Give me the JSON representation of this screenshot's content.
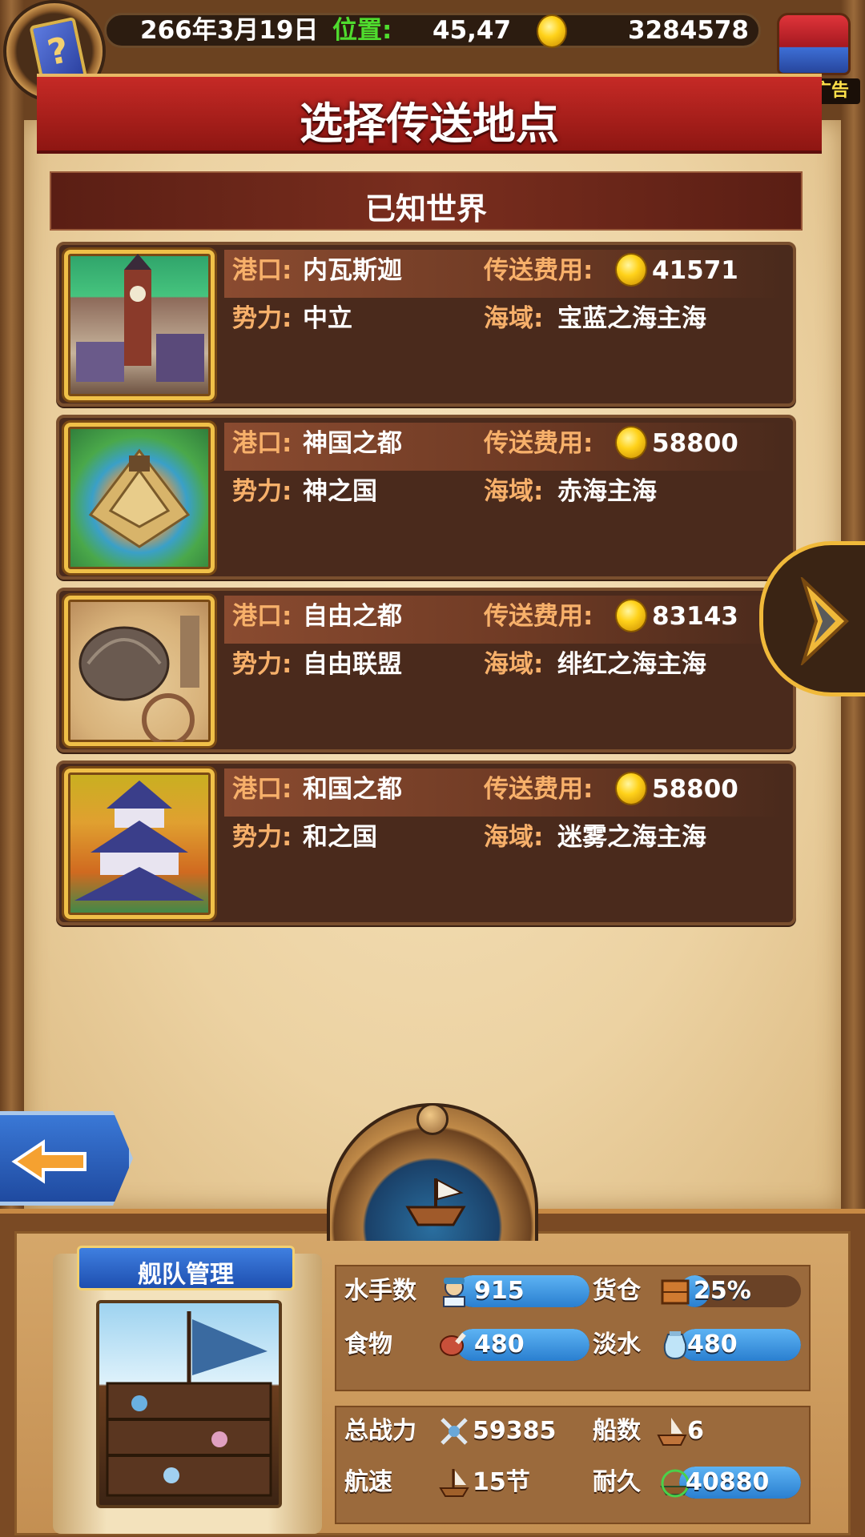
{
  "topbar": {
    "date": "266年3月19日",
    "position_label": "位置:",
    "position": "45,47",
    "gold": "3284578",
    "ad_badge": "有新广告"
  },
  "title": "选择传送地点",
  "section": "已知世界",
  "labels": {
    "port": "港口:",
    "cost": "传送费用:",
    "faction": "势力:",
    "sea": "海域:"
  },
  "ports": [
    {
      "name": "内瓦斯迦",
      "cost": "41571",
      "faction": "中立",
      "sea": "宝蓝之海主海"
    },
    {
      "name": "神国之都",
      "cost": "58800",
      "faction": "神之国",
      "sea": "赤海主海"
    },
    {
      "name": "自由之都",
      "cost": "83143",
      "faction": "自由联盟",
      "sea": "绯红之海主海"
    },
    {
      "name": "和国之都",
      "cost": "58800",
      "faction": "和之国",
      "sea": "迷雾之海主海"
    }
  ],
  "fleet": {
    "title": "舰队管理",
    "sailors_label": "水手数",
    "sailors": "915",
    "sailors_fill": 1.0,
    "cargo_label": "货仓",
    "cargo": "25%",
    "cargo_fill": 0.25,
    "food_label": "食物",
    "food": "480",
    "food_fill": 1.0,
    "water_label": "淡水",
    "water": "480",
    "water_fill": 1.0,
    "power_label": "总战力",
    "power": "59385",
    "ships_label": "船数",
    "ships": "6",
    "speed_label": "航速",
    "speed": "15节",
    "durability_label": "耐久",
    "durability": "40880",
    "durability_fill": 1.0
  },
  "colors": {
    "accent_gold": "#f0c048",
    "label_orange": "#f7b06a",
    "position_green": "#4fdc2e",
    "bar_blue": "#2a7fd0"
  },
  "icons": {
    "codex": "book-icon",
    "chest": "treasure-chest-icon",
    "coin": "gold-coin-icon",
    "next": "chevron-right-icon",
    "back": "arrow-left-icon"
  }
}
